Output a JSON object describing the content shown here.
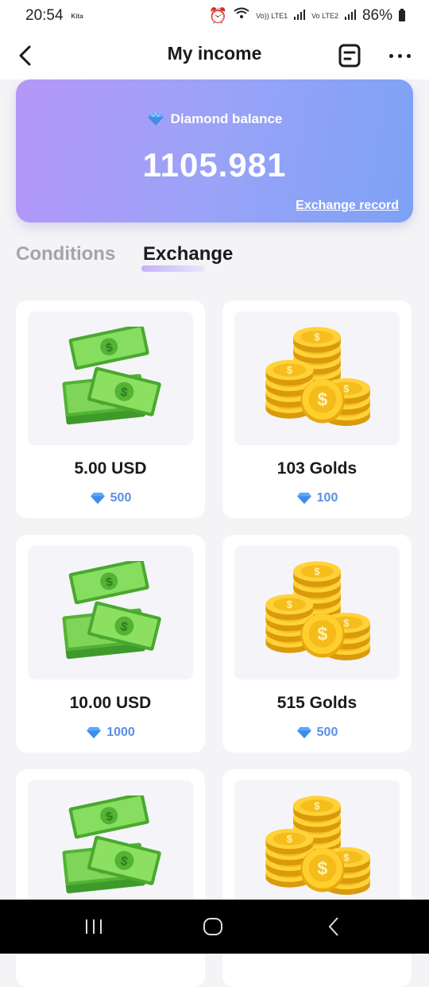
{
  "status_bar": {
    "time": "20:54",
    "carrier_icon": "Kita",
    "network_1": "Vo)) LTE1",
    "network_2": "Vo LTE2",
    "battery": "86%"
  },
  "header": {
    "title": "My income",
    "back_icon": "chevron-left-icon",
    "record_icon": "document-list-icon",
    "more_icon": "more-horizontal-icon"
  },
  "balance": {
    "label": "Diamond balance",
    "value": "1105.981",
    "record_link": "Exchange record"
  },
  "tabs": [
    {
      "label": "Conditions",
      "active": false
    },
    {
      "label": "Exchange",
      "active": true
    }
  ],
  "items": [
    {
      "title": "5.00 USD",
      "cost": "500",
      "icon": "cash-stack-icon"
    },
    {
      "title": "103 Golds",
      "cost": "100",
      "icon": "gold-coins-icon"
    },
    {
      "title": "10.00 USD",
      "cost": "1000",
      "icon": "cash-stack-icon"
    },
    {
      "title": "515 Golds",
      "cost": "500",
      "icon": "gold-coins-icon"
    },
    {
      "title": "",
      "cost": "",
      "icon": "cash-stack-icon"
    },
    {
      "title": "",
      "cost": "",
      "icon": "gold-coins-icon"
    }
  ],
  "colors": {
    "card_gradient_start": "#b497f8",
    "card_gradient_end": "#7da2f6",
    "diamond_blue": "#5b8ee6",
    "cash_green": "#5cc03a",
    "gold": "#f5c21b"
  }
}
